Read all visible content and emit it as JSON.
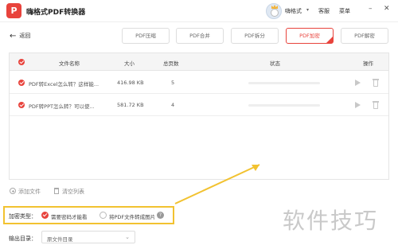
{
  "app": {
    "logo_letter": "P",
    "title": "嗨格式PDF转换器",
    "user_name": "嗨格式",
    "service": "客服",
    "menu": "菜单"
  },
  "toolbar": {
    "back_label": "返回",
    "tabs": [
      {
        "label": "PDF压缩",
        "active": false
      },
      {
        "label": "PDF合并",
        "active": false
      },
      {
        "label": "PDF拆分",
        "active": false
      },
      {
        "label": "PDF加密",
        "active": true
      },
      {
        "label": "PDF解密",
        "active": false
      }
    ]
  },
  "table": {
    "headers": {
      "filename": "文件名称",
      "size": "大小",
      "pages": "总页数",
      "status": "状态",
      "actions": "操作"
    },
    "rows": [
      {
        "filename": "PDF转Excel怎么转？这样能...",
        "size": "416.98 KB",
        "pages": "5",
        "progress": 0
      },
      {
        "filename": "PDF转PPT怎么转？可以使...",
        "size": "581.72 KB",
        "pages": "4",
        "progress": 0
      }
    ]
  },
  "actions": {
    "add_file": "添加文件",
    "clear_list": "清空列表"
  },
  "encryption": {
    "label": "加密类型：",
    "options": [
      {
        "label": "需要密码才能看",
        "selected": true
      },
      {
        "label": "将PDF文件转成图片",
        "selected": false
      }
    ],
    "help": "?"
  },
  "output": {
    "label": "输出目录：",
    "value": "原文件目录"
  },
  "watermark": "软件技巧",
  "colors": {
    "accent": "#e8433c",
    "highlight": "#f2c230"
  },
  "icons": {
    "play": "play-icon",
    "delete": "trash-icon",
    "back": "arrow-left-icon"
  }
}
